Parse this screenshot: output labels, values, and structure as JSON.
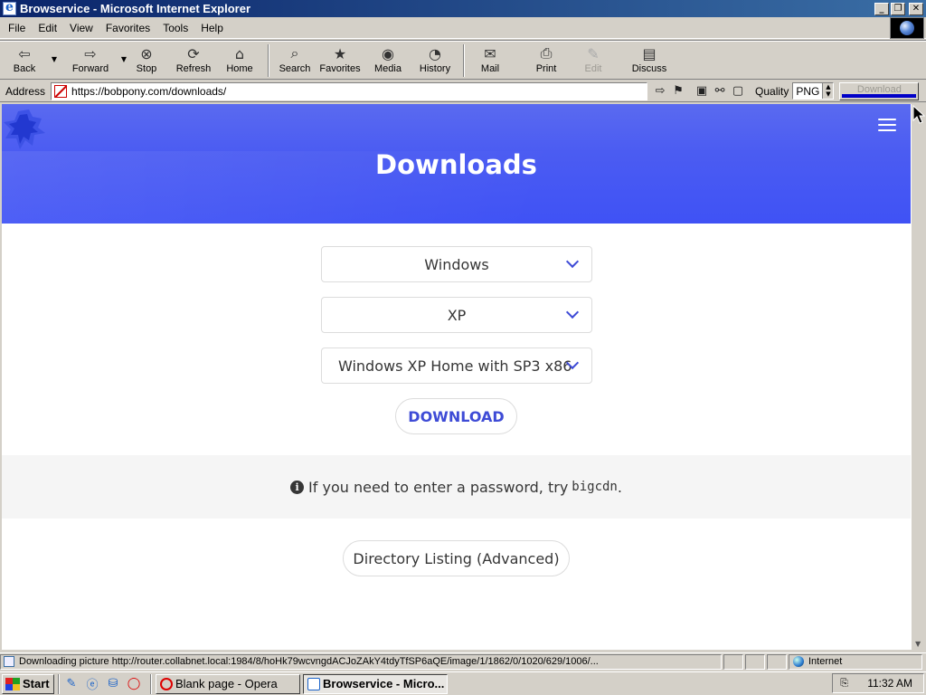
{
  "window": {
    "title": "Browservice - Microsoft Internet Explorer",
    "controls": [
      "_",
      "❐",
      "✕"
    ]
  },
  "menu": [
    "File",
    "Edit",
    "View",
    "Favorites",
    "Tools",
    "Help"
  ],
  "toolbar": {
    "back": "Back",
    "forward": "Forward",
    "stop": "Stop",
    "refresh": "Refresh",
    "home": "Home",
    "search": "Search",
    "favorites": "Favorites",
    "media": "Media",
    "history": "History",
    "mail": "Mail",
    "print": "Print",
    "edit": "Edit",
    "discuss": "Discuss"
  },
  "addressbar": {
    "label": "Address",
    "url": "https://bobpony.com/downloads/",
    "quality_label": "Quality",
    "quality_value": "PNG",
    "download_label": "Download"
  },
  "page": {
    "title": "Downloads",
    "select_os": "Windows",
    "select_version": "XP",
    "select_edition": "Windows XP Home with SP3 x86",
    "download_button": "DOWNLOAD",
    "notice_text": "If you need to enter a password, try",
    "notice_code": "bigcdn",
    "notice_end": ".",
    "directory_button": "Directory Listing (Advanced)",
    "accent_color": "#3e4bd6",
    "hero_color": "#4b5cf2"
  },
  "statusbar": {
    "text": "Downloading picture http://router.collabnet.local:1984/8/hoHk79wcvngdACJoZAkY4tdyTfSP6aQE/image/1/1862/0/1020/629/1006/...",
    "zone": "Internet"
  },
  "taskbar": {
    "start": "Start",
    "tasks": [
      "Blank page - Opera",
      "Browservice - Micro..."
    ],
    "clock": "11:32 AM"
  }
}
